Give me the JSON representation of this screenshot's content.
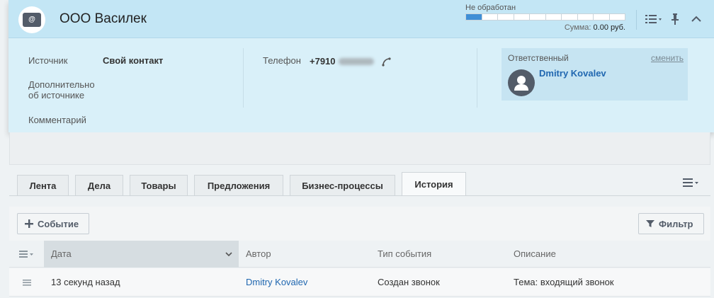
{
  "card": {
    "title": "ООО Василек",
    "badge_text": "@",
    "stage": {
      "label": "Не обработан",
      "segments_total": 10,
      "segments_active": 1,
      "progress_color": "#3f8fd6"
    },
    "sum": {
      "label": "Сумма:",
      "value": "0.00 руб."
    },
    "source": {
      "label": "Источник",
      "value": "Свой контакт"
    },
    "source_details": {
      "label_line1": "Дополнительно",
      "label_line2": "об источнике"
    },
    "comment": {
      "label": "Комментарий"
    },
    "phone": {
      "label": "Телефон",
      "value": "+7910"
    },
    "responsible": {
      "label": "Ответственный",
      "change_label": "сменить",
      "name": "Dmitry Kovalev"
    }
  },
  "tabs": [
    {
      "label": "Лента"
    },
    {
      "label": "Дела"
    },
    {
      "label": "Товары"
    },
    {
      "label": "Предложения"
    },
    {
      "label": "Бизнес-процессы"
    },
    {
      "label": "История",
      "active": true
    }
  ],
  "toolbar": {
    "add_event_label": "Событие",
    "filter_label": "Фильтр"
  },
  "grid": {
    "columns": [
      "Дата",
      "Автор",
      "Тип события",
      "Описание"
    ],
    "rows": [
      {
        "date": "13 секунд назад",
        "author": "Dmitry Kovalev",
        "event_type": "Создан звонок",
        "description": "Тема: входящий звонок"
      }
    ]
  },
  "colors": {
    "accent": "#2067b0",
    "header_bg": "#c3e6f5",
    "card_bg": "#d9f0f9"
  }
}
